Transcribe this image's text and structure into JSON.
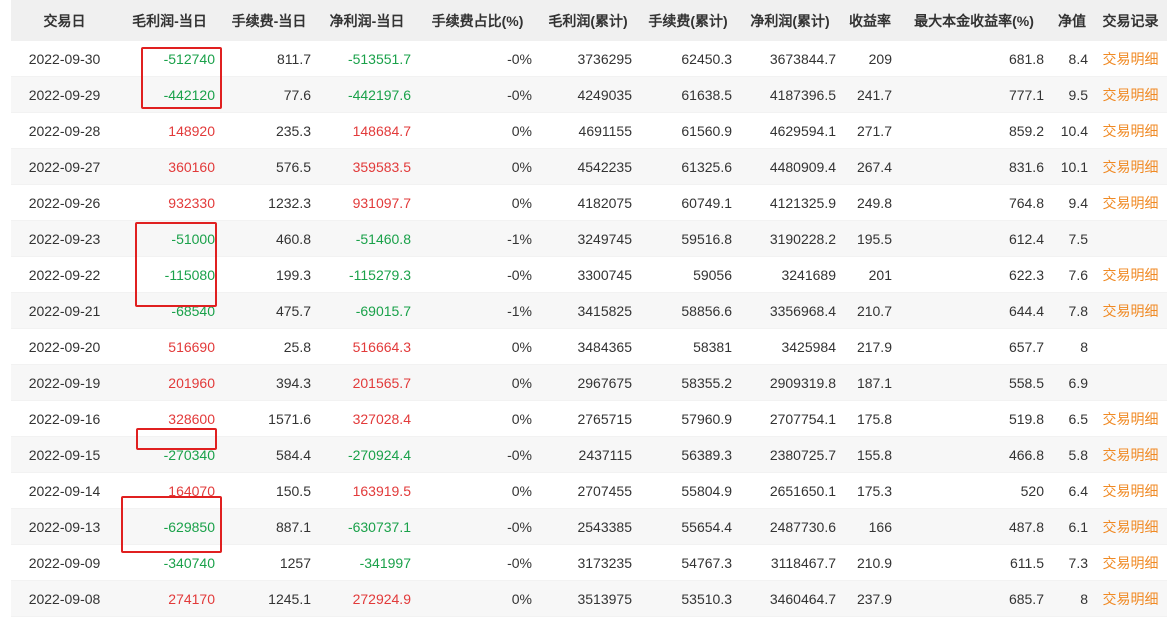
{
  "table": {
    "headers": [
      "交易日",
      "毛利润-当日",
      "手续费-当日",
      "净利润-当日",
      "手续费占比(%)",
      "毛利润(累计)",
      "手续费(累计)",
      "净利润(累计)",
      "收益率",
      "最大本金收益率(%)",
      "净值",
      "交易记录"
    ],
    "rows": [
      [
        "2022-09-30",
        "-512740",
        "811.7",
        "-513551.7",
        "-0%",
        "3736295",
        "62450.3",
        "3673844.7",
        "209",
        "681.8",
        "8.4",
        "交易明细"
      ],
      [
        "2022-09-29",
        "-442120",
        "77.6",
        "-442197.6",
        "-0%",
        "4249035",
        "61638.5",
        "4187396.5",
        "241.7",
        "777.1",
        "9.5",
        "交易明细"
      ],
      [
        "2022-09-28",
        "148920",
        "235.3",
        "148684.7",
        "0%",
        "4691155",
        "61560.9",
        "4629594.1",
        "271.7",
        "859.2",
        "10.4",
        "交易明细"
      ],
      [
        "2022-09-27",
        "360160",
        "576.5",
        "359583.5",
        "0%",
        "4542235",
        "61325.6",
        "4480909.4",
        "267.4",
        "831.6",
        "10.1",
        "交易明细"
      ],
      [
        "2022-09-26",
        "932330",
        "1232.3",
        "931097.7",
        "0%",
        "4182075",
        "60749.1",
        "4121325.9",
        "249.8",
        "764.8",
        "9.4",
        "交易明细"
      ],
      [
        "2022-09-23",
        "-51000",
        "460.8",
        "-51460.8",
        "-1%",
        "3249745",
        "59516.8",
        "3190228.2",
        "195.5",
        "612.4",
        "7.5",
        ""
      ],
      [
        "2022-09-22",
        "-115080",
        "199.3",
        "-115279.3",
        "-0%",
        "3300745",
        "59056",
        "3241689",
        "201",
        "622.3",
        "7.6",
        "交易明细"
      ],
      [
        "2022-09-21",
        "-68540",
        "475.7",
        "-69015.7",
        "-1%",
        "3415825",
        "58856.6",
        "3356968.4",
        "210.7",
        "644.4",
        "7.8",
        "交易明细"
      ],
      [
        "2022-09-20",
        "516690",
        "25.8",
        "516664.3",
        "0%",
        "3484365",
        "58381",
        "3425984",
        "217.9",
        "657.7",
        "8",
        ""
      ],
      [
        "2022-09-19",
        "201960",
        "394.3",
        "201565.7",
        "0%",
        "2967675",
        "58355.2",
        "2909319.8",
        "187.1",
        "558.5",
        "6.9",
        ""
      ],
      [
        "2022-09-16",
        "328600",
        "1571.6",
        "327028.4",
        "0%",
        "2765715",
        "57960.9",
        "2707754.1",
        "175.8",
        "519.8",
        "6.5",
        "交易明细"
      ],
      [
        "2022-09-15",
        "-270340",
        "584.4",
        "-270924.4",
        "-0%",
        "2437115",
        "56389.3",
        "2380725.7",
        "155.8",
        "466.8",
        "5.8",
        "交易明细"
      ],
      [
        "2022-09-14",
        "164070",
        "150.5",
        "163919.5",
        "0%",
        "2707455",
        "55804.9",
        "2651650.1",
        "175.3",
        "520",
        "6.4",
        "交易明细"
      ],
      [
        "2022-09-13",
        "-629850",
        "887.1",
        "-630737.1",
        "-0%",
        "2543385",
        "55654.4",
        "2487730.6",
        "166",
        "487.8",
        "6.1",
        "交易明细"
      ],
      [
        "2022-09-09",
        "-340740",
        "1257",
        "-341997",
        "-0%",
        "3173235",
        "54767.3",
        "3118467.7",
        "210.9",
        "611.5",
        "7.3",
        "交易明细"
      ],
      [
        "2022-09-08",
        "274170",
        "1245.1",
        "272924.9",
        "0%",
        "3513975",
        "53510.3",
        "3460464.7",
        "237.9",
        "685.7",
        "8",
        "交易明细"
      ]
    ]
  },
  "colors": {
    "negative": "#1aa14a",
    "positive": "#e23a3a",
    "link": "#f08a24",
    "annotation": "#e02020",
    "header_bg": "#f0f0f0"
  }
}
